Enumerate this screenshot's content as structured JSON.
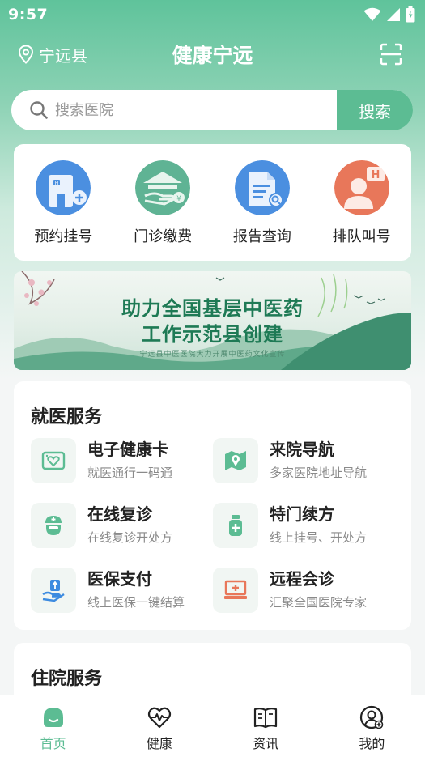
{
  "status_bar": {
    "time": "9:57",
    "icons": [
      "wifi-icon",
      "signal-icon",
      "battery-charging-icon"
    ]
  },
  "header": {
    "location": "宁远县",
    "title": "健康宁远",
    "scan_icon": "scan-icon"
  },
  "search": {
    "placeholder": "搜索医院",
    "value": "",
    "button_label": "搜索"
  },
  "quick_actions": [
    {
      "label": "预约挂号",
      "icon": "hospital-icon"
    },
    {
      "label": "门诊缴费",
      "icon": "payment-icon"
    },
    {
      "label": "报告查询",
      "icon": "report-search-icon"
    },
    {
      "label": "排队叫号",
      "icon": "queue-call-icon"
    }
  ],
  "banner": {
    "line1": "助力全国基层中医药",
    "line2": "工作示范县创建",
    "subtitle": "宁远县中医医院大力开展中医药文化宣传"
  },
  "medical_services": {
    "title": "就医服务",
    "items": [
      {
        "name": "电子健康卡",
        "desc": "就医通行一码通",
        "icon": "health-card-icon"
      },
      {
        "name": "来院导航",
        "desc": "多家医院地址导航",
        "icon": "map-navigation-icon"
      },
      {
        "name": "在线复诊",
        "desc": "在线复诊开处方",
        "icon": "doctor-icon"
      },
      {
        "name": "特门续方",
        "desc": "线上挂号、开处方",
        "icon": "medicine-bottle-icon"
      },
      {
        "name": "医保支付",
        "desc": "线上医保一键结算",
        "icon": "insurance-pay-icon"
      },
      {
        "name": "远程会诊",
        "desc": "汇聚全国医院专家",
        "icon": "remote-consult-icon"
      }
    ]
  },
  "inpatient_services": {
    "title": "住院服务"
  },
  "tab_bar": {
    "active": "首页",
    "tabs": [
      {
        "label": "首页",
        "icon": "home-icon"
      },
      {
        "label": "健康",
        "icon": "heart-pulse-icon"
      },
      {
        "label": "资讯",
        "icon": "book-icon"
      },
      {
        "label": "我的",
        "icon": "profile-icon"
      }
    ]
  },
  "colors": {
    "brand": "#5cbc93",
    "header_green": "#5fc39b",
    "text_dark": "#222222",
    "text_muted": "#8a8a8a"
  }
}
